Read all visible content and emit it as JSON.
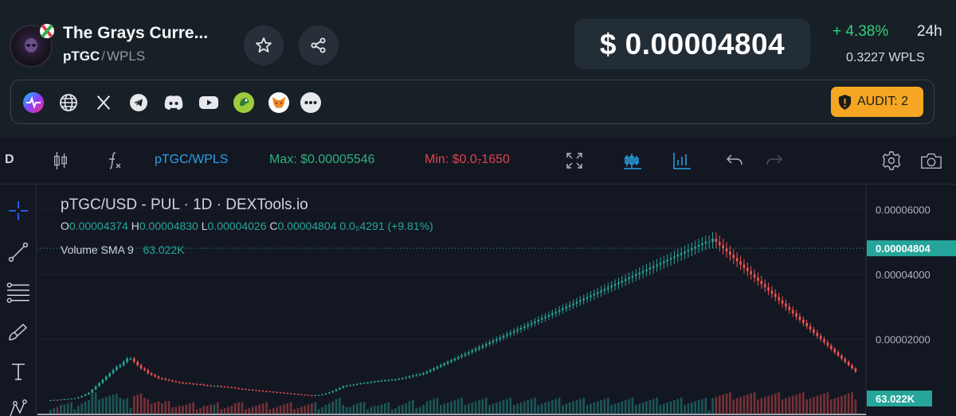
{
  "token": {
    "name": "The Grays Curre...",
    "base": "pTGC",
    "quote": "WPLS",
    "separator": "/"
  },
  "price": {
    "usd": "$ 0.00004804",
    "change": "+ 4.38%",
    "period": "24h",
    "quote_price": "0.3227  WPLS"
  },
  "links": [
    "pulse-icon",
    "globe-icon",
    "x-icon",
    "telegram-icon",
    "discord-icon",
    "youtube-icon",
    "dextools-icon",
    "metamask-icon",
    "more-icon"
  ],
  "audit": {
    "label": "AUDIT: 2"
  },
  "toolbar": {
    "interval": "D",
    "pair": "pTGC/WPLS",
    "max": "Max: $0.00005546",
    "min": "Min: $0.0₇1650"
  },
  "legend": {
    "title": "pTGC/USD - PUL · 1D · DEXTools.io",
    "o_label": "O",
    "o": "0.00004374",
    "h_label": "H",
    "h": "0.00004830",
    "l_label": "L",
    "l": "0.00004026",
    "c_label": "C",
    "c": "0.00004804",
    "change": "0.0₅4291 (+9.81%)",
    "volume_label": "Volume SMA 9",
    "volume_value": "63.022K"
  },
  "axis": {
    "ticks": [
      "0.00006000",
      "0.00004000",
      "0.00002000"
    ],
    "current_price": "0.00004804",
    "current_volume": "63.022K"
  },
  "colors": {
    "up": "#26a69a",
    "down": "#ef5350",
    "accent": "#2962ff",
    "audit": "#f5a623",
    "positive": "#2fd17a"
  },
  "chart_data": {
    "type": "candlestick",
    "y_range": [
      0,
      6.5e-05
    ],
    "close": [
      1.2e-06,
      1.3e-06,
      1.2e-06,
      1.4e-06,
      1.5e-06,
      1.6e-06,
      1.7e-06,
      1.8e-06,
      2.1e-06,
      2.5e-06,
      3e-06,
      3.5e-06,
      4.5e-06,
      5.5e-06,
      6.5e-06,
      7.5e-06,
      8.5e-06,
      9.5e-06,
      1.05e-05,
      1.15e-05,
      1.2e-05,
      1.3e-05,
      1.4e-05,
      1.4e-05,
      1.3e-05,
      1.2e-05,
      1.1e-05,
      1.05e-05,
      9.5e-06,
      9e-06,
      8.5e-06,
      8e-06,
      7.8e-06,
      7.5e-06,
      7.3e-06,
      7e-06,
      6.8e-06,
      6.6e-06,
      6.5e-06,
      6.4e-06,
      6.3e-06,
      6.2e-06,
      6.1e-06,
      6e-06,
      5.8e-06,
      5.7e-06,
      5.6e-06,
      5.6e-06,
      5.5e-06,
      5.4e-06,
      5.3e-06,
      5.2e-06,
      5.1e-06,
      4.9e-06,
      4.7e-06,
      4.6e-06,
      4.5e-06,
      4.4e-06,
      4.3e-06,
      4.2e-06,
      4.1e-06,
      4e-06,
      3.9e-06,
      3.8e-06,
      3.7e-06,
      3.6e-06,
      3.5e-06,
      3.4e-06,
      3.3e-06,
      3.2e-06,
      3.1e-06,
      3e-06,
      2.9e-06,
      2.8e-06,
      2.7e-06,
      2.6e-06,
      2.7e-06,
      2.8e-06,
      3e-06,
      3.3e-06,
      3.6e-06,
      4e-06,
      4.5e-06,
      5e-06,
      5.5e-06,
      5.7e-06,
      5.8e-06,
      6e-06,
      6.2e-06,
      6.4e-06,
      6.5e-06,
      6.6e-06,
      6.8e-06,
      7e-06,
      7.1e-06,
      7.2e-06,
      7.3e-06,
      7.4e-06,
      7.5e-06,
      7.6e-06,
      7.8e-06,
      8e-06,
      8.2e-06,
      8.5e-06,
      8.8e-06,
      9e-06,
      9.2e-06,
      9.5e-06,
      1e-05,
      1.05e-05,
      1.1e-05,
      1.15e-05,
      1.2e-05,
      1.25e-05,
      1.3e-05,
      1.35e-05,
      1.4e-05,
      1.45e-05,
      1.5e-05,
      1.55e-05,
      1.6e-05,
      1.65e-05,
      1.7e-05,
      1.75e-05,
      1.8e-05,
      1.85e-05,
      1.9e-05,
      1.95e-05,
      2e-05,
      2.05e-05,
      2.1e-05,
      2.15e-05,
      2.2e-05,
      2.25e-05,
      2.3e-05,
      2.35e-05,
      2.4e-05,
      2.45e-05,
      2.5e-05,
      2.55e-05,
      2.6e-05,
      2.65e-05,
      2.7e-05,
      2.75e-05,
      2.8e-05,
      2.85e-05,
      2.9e-05,
      2.95e-05,
      3e-05,
      3.05e-05,
      3.1e-05,
      3.15e-05,
      3.2e-05,
      3.25e-05,
      3.3e-05,
      3.35e-05,
      3.4e-05,
      3.45e-05,
      3.5e-05,
      3.55e-05,
      3.6e-05,
      3.65e-05,
      3.7e-05,
      3.75e-05,
      3.8e-05,
      3.85e-05,
      3.9e-05,
      3.95e-05,
      4e-05,
      4.05e-05,
      4.1e-05,
      4.15e-05,
      4.2e-05,
      4.25e-05,
      4.3e-05,
      4.35e-05,
      4.4e-05,
      4.45e-05,
      4.5e-05,
      4.55e-05,
      4.6e-05,
      4.65e-05,
      4.7e-05,
      4.75e-05,
      4.8e-05,
      4.85e-05,
      4.9e-05,
      4.95e-05,
      5e-05,
      5e-05,
      5.1e-05,
      5e-05,
      4.9e-05,
      4.8e-05,
      4.7e-05,
      4.6e-05,
      4.5e-05,
      4.4e-05,
      4.3e-05,
      4.2e-05,
      4.1e-05,
      4e-05,
      3.9e-05,
      3.8e-05,
      3.7e-05,
      3.6e-05,
      3.5e-05,
      3.4e-05,
      3.3e-05,
      3.2e-05,
      3.1e-05,
      3e-05,
      2.9e-05,
      2.8e-05,
      2.7e-05,
      2.6e-05,
      2.5e-05,
      2.4e-05,
      2.3e-05,
      2.2e-05,
      2.1e-05,
      2e-05,
      1.9e-05,
      1.8e-05,
      1.7e-05,
      1.6e-05,
      1.5e-05,
      1.4e-05,
      1.3e-05,
      1.2e-05,
      1.1e-05,
      1e-05
    ],
    "note": ""
  }
}
